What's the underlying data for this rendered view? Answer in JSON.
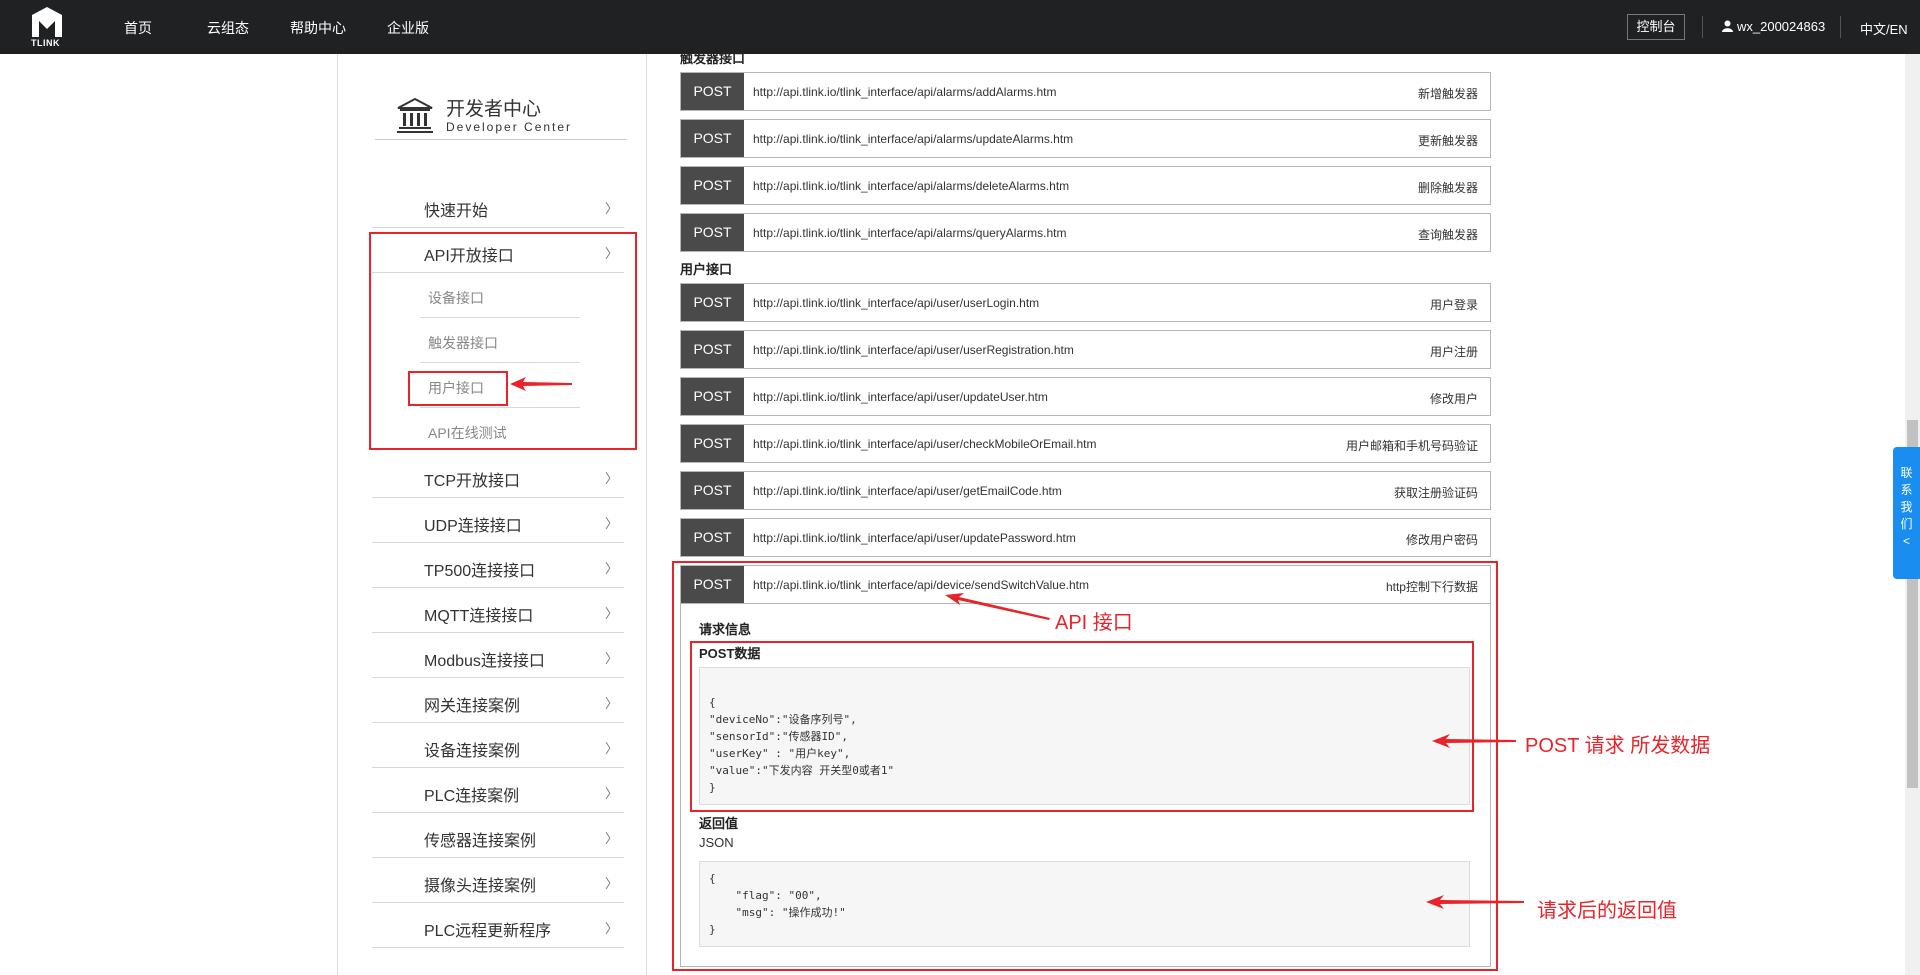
{
  "header": {
    "logo_text": "TLINK",
    "nav": [
      "首页",
      "云组态",
      "帮助中心",
      "企业版"
    ],
    "console": "控制台",
    "user": "wx_200024863",
    "lang": "中文/EN"
  },
  "sidebar": {
    "title": "开发者中心",
    "subtitle": "Developer  Center",
    "items": [
      {
        "label": "快速开始",
        "chev": "〉"
      },
      {
        "label": "API开放接口",
        "chev": "〉"
      },
      {
        "label": "TCP开放接口",
        "chev": "〉"
      },
      {
        "label": "UDP连接接口",
        "chev": "〉"
      },
      {
        "label": "TP500连接接口",
        "chev": "〉"
      },
      {
        "label": "MQTT连接接口",
        "chev": "〉"
      },
      {
        "label": "Modbus连接接口",
        "chev": "〉"
      },
      {
        "label": "网关连接案例",
        "chev": "〉"
      },
      {
        "label": "设备连接案例",
        "chev": "〉"
      },
      {
        "label": "PLC连接案例",
        "chev": "〉"
      },
      {
        "label": "传感器连接案例",
        "chev": "〉"
      },
      {
        "label": "摄像头连接案例",
        "chev": "〉"
      },
      {
        "label": "PLC远程更新程序",
        "chev": "〉"
      }
    ],
    "subitems": [
      "设备接口",
      "触发器接口",
      "用户接口",
      "API在线测试"
    ]
  },
  "content": {
    "trigger_section": "触发器接口",
    "user_section": "用户接口",
    "trigger_apis": [
      {
        "method": "POST",
        "url": "http://api.tlink.io/tlink_interface/api/alarms/addAlarms.htm",
        "desc": "新增触发器"
      },
      {
        "method": "POST",
        "url": "http://api.tlink.io/tlink_interface/api/alarms/updateAlarms.htm",
        "desc": "更新触发器"
      },
      {
        "method": "POST",
        "url": "http://api.tlink.io/tlink_interface/api/alarms/deleteAlarms.htm",
        "desc": "删除触发器"
      },
      {
        "method": "POST",
        "url": "http://api.tlink.io/tlink_interface/api/alarms/queryAlarms.htm",
        "desc": "查询触发器"
      }
    ],
    "user_apis": [
      {
        "method": "POST",
        "url": "http://api.tlink.io/tlink_interface/api/user/userLogin.htm",
        "desc": "用户登录"
      },
      {
        "method": "POST",
        "url": "http://api.tlink.io/tlink_interface/api/user/userRegistration.htm",
        "desc": "用户注册"
      },
      {
        "method": "POST",
        "url": "http://api.tlink.io/tlink_interface/api/user/updateUser.htm",
        "desc": "修改用户"
      },
      {
        "method": "POST",
        "url": "http://api.tlink.io/tlink_interface/api/user/checkMobileOrEmail.htm",
        "desc": "用户邮箱和手机号码验证"
      },
      {
        "method": "POST",
        "url": "http://api.tlink.io/tlink_interface/api/user/getEmailCode.htm",
        "desc": "获取注册验证码"
      },
      {
        "method": "POST",
        "url": "http://api.tlink.io/tlink_interface/api/user/updatePassword.htm",
        "desc": "修改用户密码"
      },
      {
        "method": "POST",
        "url": "http://api.tlink.io/tlink_interface/api/device/sendSwitchValue.htm",
        "desc": "http控制下行数据"
      }
    ],
    "detail": {
      "request_info": "请求信息",
      "post_data": "POST数据",
      "post_code": "{\n\"deviceNo\":\"设备序列号\",\n\"sensorId\":\"传感器ID\",\n\"userKey\" : \"用户key\",\n\"value\":\"下发内容 开关型0或者1\"\n}",
      "return_label": "返回值",
      "return_type": "JSON",
      "return_code": "{\n    \"flag\": \"00\",\n    \"msg\": \"操作成功!\"\n}"
    }
  },
  "annotations": {
    "api": "API 接口",
    "post": "POST 请求 所发数据",
    "ret": "请求后的返回值"
  },
  "contact": [
    "联",
    "系",
    "我",
    "们",
    "<"
  ],
  "colors": {
    "header_bg": "#1f2123",
    "method_bg": "#4a4a4a",
    "annotation": "#e8242a",
    "contact_bg": "#1a8ef0"
  }
}
